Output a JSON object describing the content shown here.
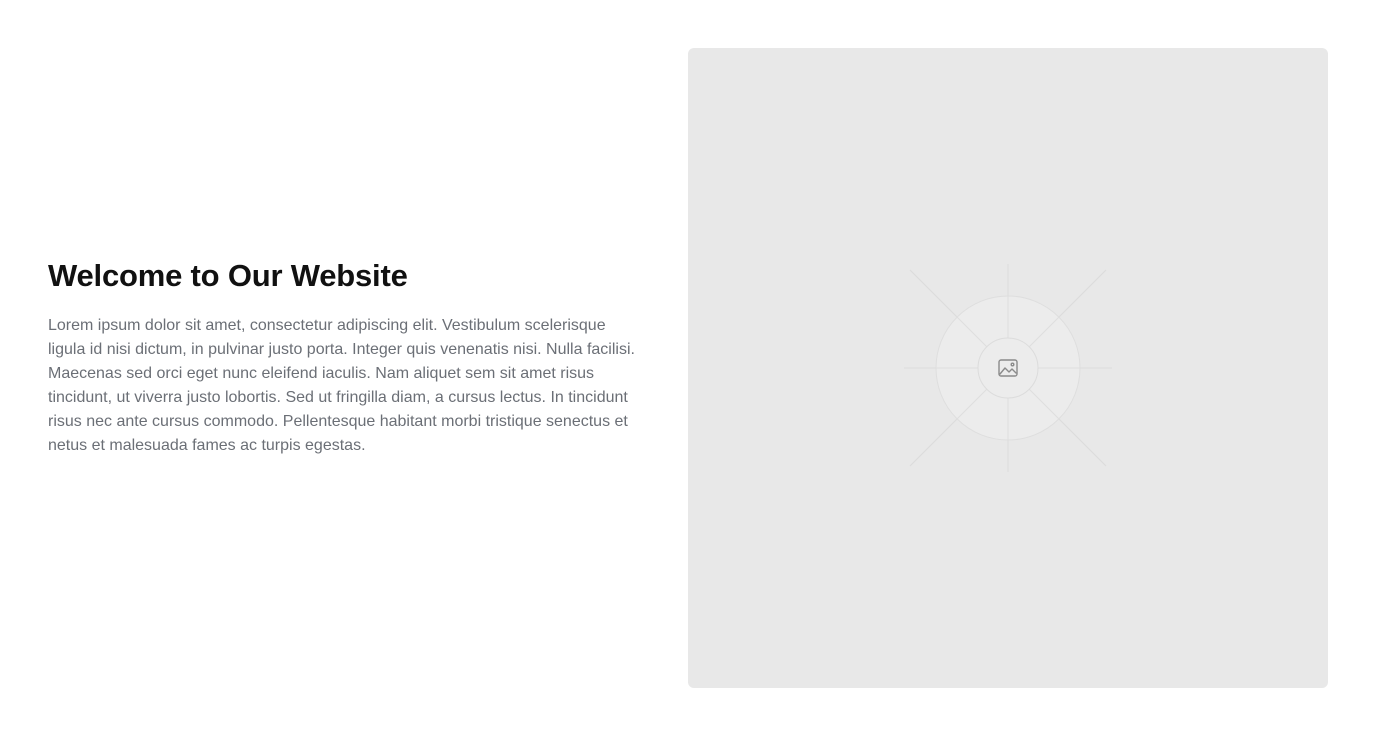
{
  "hero": {
    "title": "Welcome to Our Website",
    "body": "Lorem ipsum dolor sit amet, consectetur adipiscing elit. Vestibulum scelerisque ligula id nisi dictum, in pulvinar justo porta. Integer quis venenatis nisi. Nulla facilisi. Maecenas sed orci eget nunc eleifend iaculis. Nam aliquet sem sit amet risus tincidunt, ut viverra justo lobortis. Sed ut fringilla diam, a cursus lectus. In tincidunt risus nec ante cursus commodo. Pellentesque habitant morbi tristique senectus et netus et malesuada fames ac turpis egestas."
  },
  "image": {
    "icon": "image-icon"
  },
  "colors": {
    "background": "#ffffff",
    "title": "#111111",
    "body_text": "#6b6f76",
    "placeholder_bg": "#e8e8e8",
    "placeholder_lines": "#dcdcdc",
    "icon": "#8a8a8a"
  }
}
